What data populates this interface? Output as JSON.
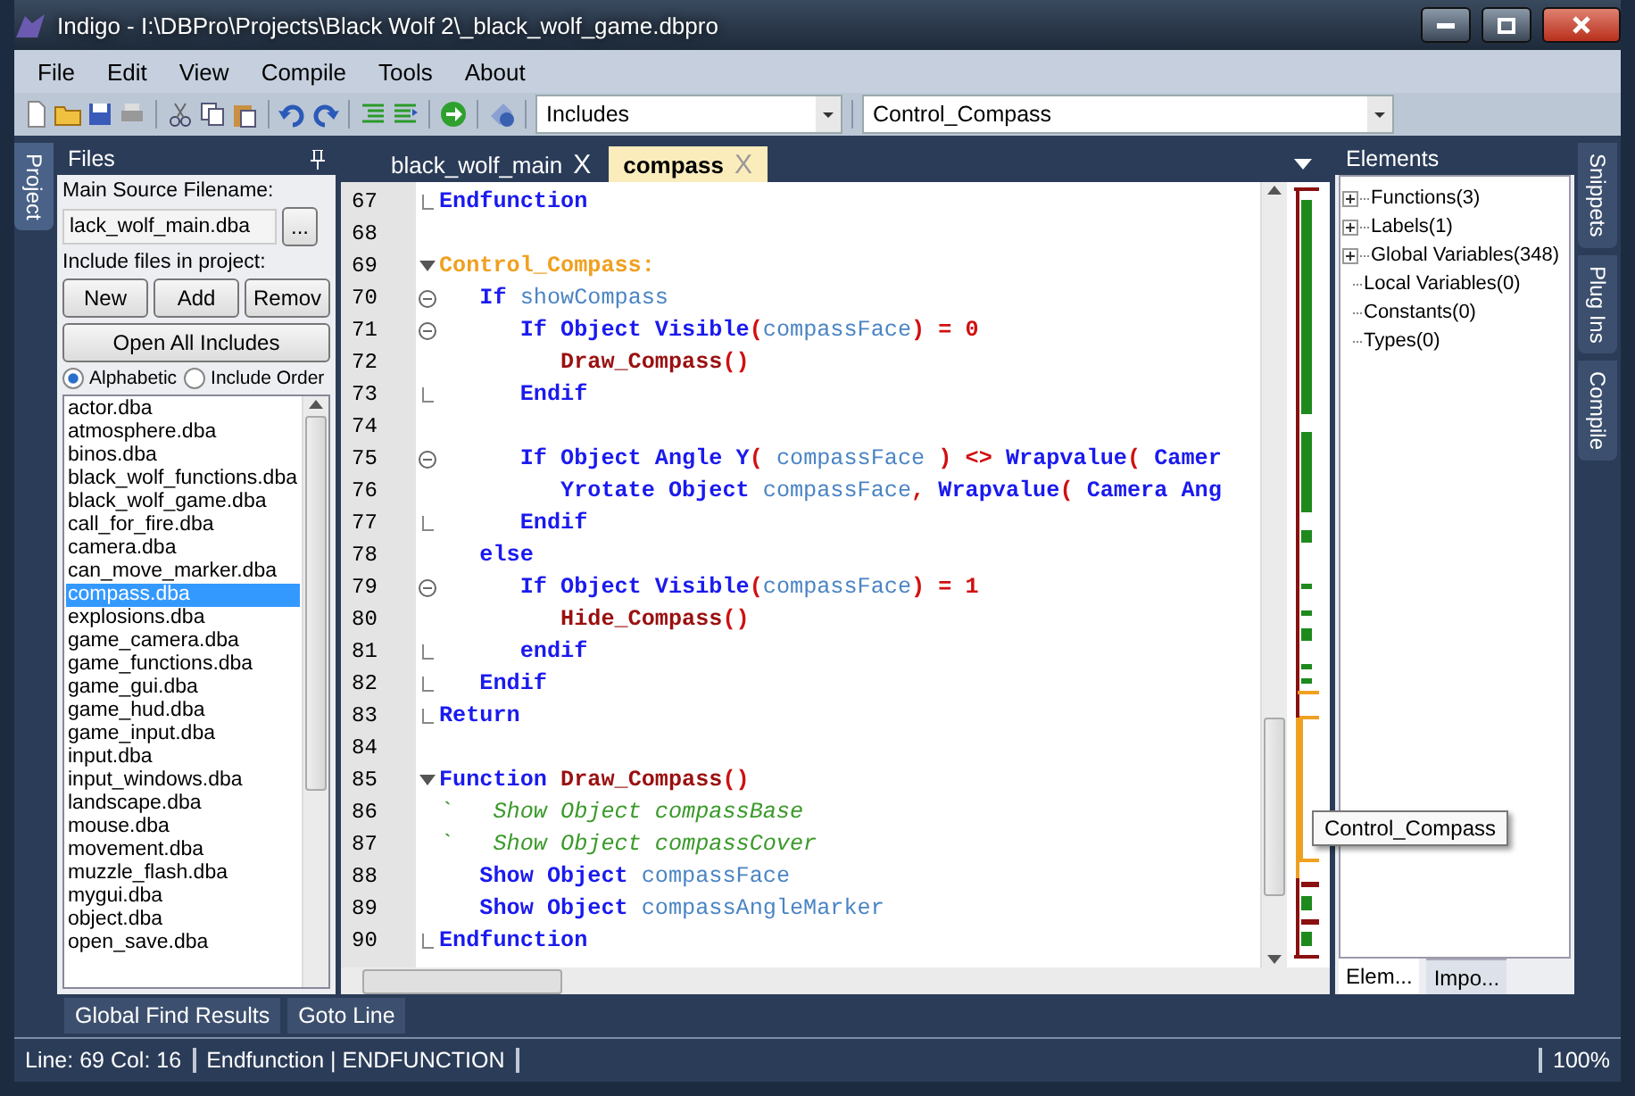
{
  "window": {
    "title": "Indigo - I:\\DBPro\\Projects\\Black Wolf 2\\_black_wolf_game.dbpro"
  },
  "menu": [
    {
      "label": "File"
    },
    {
      "label": "Edit"
    },
    {
      "label": "View"
    },
    {
      "label": "Compile"
    },
    {
      "label": "Tools"
    },
    {
      "label": "About"
    }
  ],
  "toolbar": {
    "include_combo": {
      "value": "Includes"
    },
    "label_combo": {
      "value": "Control_Compass"
    }
  },
  "left_strip": [
    {
      "label": "Project",
      "selected": true
    }
  ],
  "files_panel": {
    "title": "Files",
    "main_source_label": "Main Source Filename:",
    "main_source": {
      "value": "lack_wolf_main.dba"
    },
    "browse_button": "...",
    "include_label": "Include files in project:",
    "buttons": [
      "New",
      "Add",
      "Remov"
    ],
    "open_all_button": "Open All Includes",
    "sort": [
      {
        "label": "Alphabetic",
        "selected": true
      },
      {
        "label": "Include Order",
        "selected": false
      }
    ],
    "files": [
      {
        "name": "actor.dba",
        "selected": false
      },
      {
        "name": "atmosphere.dba",
        "selected": false
      },
      {
        "name": "binos.dba",
        "selected": false
      },
      {
        "name": "black_wolf_functions.dba",
        "selected": false
      },
      {
        "name": "black_wolf_game.dba",
        "selected": false
      },
      {
        "name": "call_for_fire.dba",
        "selected": false
      },
      {
        "name": "camera.dba",
        "selected": false
      },
      {
        "name": "can_move_marker.dba",
        "selected": false
      },
      {
        "name": "compass.dba",
        "selected": true
      },
      {
        "name": "explosions.dba",
        "selected": false
      },
      {
        "name": "game_camera.dba",
        "selected": false
      },
      {
        "name": "game_functions.dba",
        "selected": false
      },
      {
        "name": "game_gui.dba",
        "selected": false
      },
      {
        "name": "game_hud.dba",
        "selected": false
      },
      {
        "name": "game_input.dba",
        "selected": false
      },
      {
        "name": "input.dba",
        "selected": false
      },
      {
        "name": "input_windows.dba",
        "selected": false
      },
      {
        "name": "landscape.dba",
        "selected": false
      },
      {
        "name": "mouse.dba",
        "selected": false
      },
      {
        "name": "movement.dba",
        "selected": false
      },
      {
        "name": "muzzle_flash.dba",
        "selected": false
      },
      {
        "name": "mygui.dba",
        "selected": false
      },
      {
        "name": "object.dba",
        "selected": false
      },
      {
        "name": "open_save.dba",
        "selected": false
      }
    ]
  },
  "editor": {
    "tabs": [
      {
        "label": "black_wolf_main",
        "selected": false,
        "close": "X"
      },
      {
        "label": "compass",
        "selected": true,
        "close": "X"
      }
    ],
    "lines": [
      {
        "number": "67",
        "kind": "fold_end",
        "tokens": [
          {
            "kind": "keyword",
            "text": "Endfunction"
          }
        ]
      },
      {
        "number": "68",
        "kind": "plain"
      },
      {
        "number": "69",
        "kind": "fold_start",
        "tokens": [
          {
            "kind": "label",
            "text": "Control_Compass:"
          }
        ]
      },
      {
        "number": "70",
        "kind": "fold_block",
        "tokens": [
          {
            "kind": "keyword",
            "text": "   If"
          },
          {
            "kind": "ident",
            "text": " showCompass"
          }
        ]
      },
      {
        "number": "71",
        "kind": "fold_block",
        "tokens": [
          {
            "kind": "keyword",
            "text": "      If Object Visible"
          },
          {
            "kind": "op",
            "text": "("
          },
          {
            "kind": "ident",
            "text": "compassFace"
          },
          {
            "kind": "op",
            "text": ") = 0"
          }
        ]
      },
      {
        "number": "72",
        "kind": "plain",
        "tokens": [
          {
            "kind": "func",
            "text": "         Draw_Compass"
          },
          {
            "kind": "op",
            "text": "()"
          }
        ]
      },
      {
        "number": "73",
        "kind": "fold_end",
        "tokens": [
          {
            "kind": "keyword",
            "text": "      Endif"
          }
        ]
      },
      {
        "number": "74",
        "kind": "plain"
      },
      {
        "number": "75",
        "kind": "fold_block",
        "tokens": [
          {
            "kind": "keyword",
            "text": "      If Object Angle Y"
          },
          {
            "kind": "op",
            "text": "( "
          },
          {
            "kind": "ident",
            "text": "compassFace"
          },
          {
            "kind": "op",
            "text": " ) <> "
          },
          {
            "kind": "keyword",
            "text": "Wrapvalue"
          },
          {
            "kind": "op",
            "text": "( "
          },
          {
            "kind": "keyword",
            "text": "Camer"
          }
        ]
      },
      {
        "number": "76",
        "kind": "plain",
        "tokens": [
          {
            "kind": "keyword",
            "text": "         Yrotate Object"
          },
          {
            "kind": "ident",
            "text": " compassFace"
          },
          {
            "kind": "op",
            "text": ", "
          },
          {
            "kind": "keyword",
            "text": "Wrapvalue"
          },
          {
            "kind": "op",
            "text": "( "
          },
          {
            "kind": "keyword",
            "text": "Camera Ang"
          }
        ]
      },
      {
        "number": "77",
        "kind": "fold_end",
        "tokens": [
          {
            "kind": "keyword",
            "text": "      Endif"
          }
        ]
      },
      {
        "number": "78",
        "kind": "plain",
        "tokens": [
          {
            "kind": "keyword",
            "text": "   else"
          }
        ]
      },
      {
        "number": "79",
        "kind": "fold_block",
        "tokens": [
          {
            "kind": "keyword",
            "text": "      If Object Visible"
          },
          {
            "kind": "op",
            "text": "("
          },
          {
            "kind": "ident",
            "text": "compassFace"
          },
          {
            "kind": "op",
            "text": ") = 1"
          }
        ]
      },
      {
        "number": "80",
        "kind": "plain",
        "tokens": [
          {
            "kind": "func",
            "text": "         Hide_Compass"
          },
          {
            "kind": "op",
            "text": "()"
          }
        ]
      },
      {
        "number": "81",
        "kind": "fold_end",
        "tokens": [
          {
            "kind": "keyword",
            "text": "      endif"
          }
        ]
      },
      {
        "number": "82",
        "kind": "fold_end",
        "tokens": [
          {
            "kind": "keyword",
            "text": "   Endif"
          }
        ]
      },
      {
        "number": "83",
        "kind": "fold_end",
        "tokens": [
          {
            "kind": "keyword",
            "text": "Return"
          }
        ]
      },
      {
        "number": "84",
        "kind": "plain"
      },
      {
        "number": "85",
        "kind": "fold_start",
        "tokens": [
          {
            "kind": "keyword",
            "text": "Function"
          },
          {
            "kind": "func",
            "text": " Draw_Compass"
          },
          {
            "kind": "op",
            "text": "()"
          }
        ]
      },
      {
        "number": "86",
        "kind": "plain",
        "tokens": [
          {
            "kind": "comment",
            "text": "`   Show Object compassBase"
          }
        ]
      },
      {
        "number": "87",
        "kind": "plain",
        "tokens": [
          {
            "kind": "comment",
            "text": "`   Show Object compassCover"
          }
        ]
      },
      {
        "number": "88",
        "kind": "plain",
        "tokens": [
          {
            "kind": "keyword",
            "text": "   Show Object"
          },
          {
            "kind": "ident",
            "text": " compassFace"
          }
        ]
      },
      {
        "number": "89",
        "kind": "plain",
        "tokens": [
          {
            "kind": "keyword",
            "text": "   Show Object"
          },
          {
            "kind": "ident",
            "text": " compassAngleMarker"
          }
        ]
      },
      {
        "number": "90",
        "kind": "fold_end",
        "tokens": [
          {
            "kind": "keyword",
            "text": "Endfunction"
          }
        ]
      }
    ],
    "tooltip": "Control_Compass"
  },
  "elements_panel": {
    "title": "Elements",
    "items": [
      {
        "label": "Functions(3)",
        "expandable": true
      },
      {
        "label": "Labels(1)",
        "expandable": true
      },
      {
        "label": "Global Variables(348)",
        "expandable": true
      },
      {
        "label": "Local Variables(0)",
        "expandable": false
      },
      {
        "label": "Constants(0)",
        "expandable": false
      },
      {
        "label": "Types(0)",
        "expandable": false
      }
    ],
    "tabs": [
      {
        "label": "Elem...",
        "selected": true
      },
      {
        "label": "Impo...",
        "selected": false
      }
    ]
  },
  "right_strip": [
    {
      "label": "Snippets"
    },
    {
      "label": "Plug Ins"
    },
    {
      "label": "Compile"
    }
  ],
  "bottom_tabs": [
    {
      "label": "Global Find Results"
    },
    {
      "label": "Goto Line"
    }
  ],
  "status_bar": {
    "position": "Line: 69 Col: 16",
    "context": "Endfunction | ENDFUNCTION",
    "zoom": "100%"
  }
}
